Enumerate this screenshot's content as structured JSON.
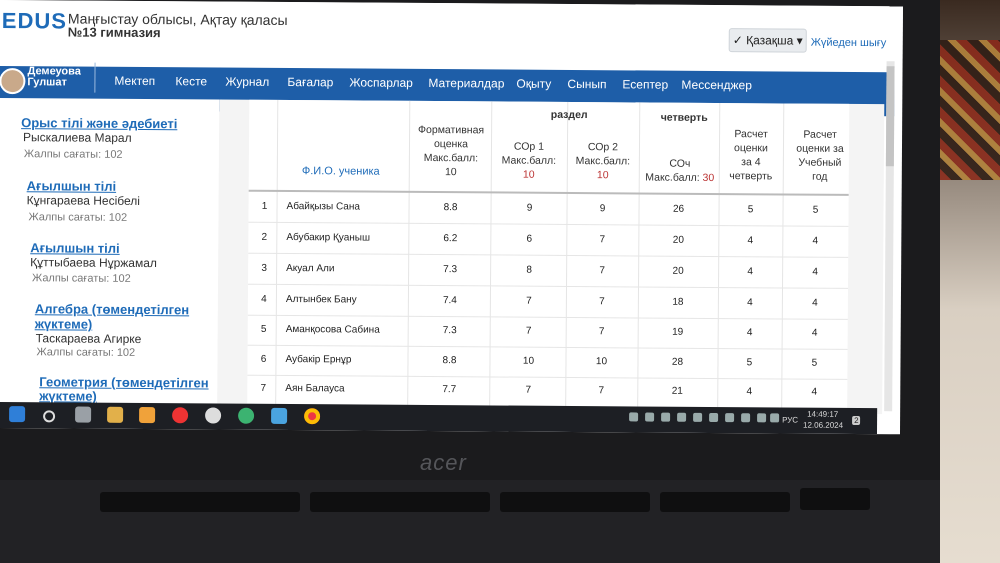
{
  "header": {
    "logo": "EDUS",
    "region": "Маңғыстау облысы, Ақтау қаласы",
    "school": "№13 гимназия",
    "language_button": "✓ Қазақша ▾",
    "logout": "Жүйеден шығу"
  },
  "user": {
    "name_line1": "Демеуова",
    "name_line2": "Гулшат"
  },
  "nav": [
    "Мектеп",
    "Кесте",
    "Журнал",
    "Бағалар",
    "Жоспарлар",
    "Материалдар",
    "Оқыту",
    "Сынып",
    "Есептер",
    "Мессенджер"
  ],
  "sidebar": {
    "subjects": [
      {
        "name": "Орыс тілі және әдебиеті",
        "teacher": "Рыскалиева Марал",
        "hours": "Жалпы сағаты: 102"
      },
      {
        "name": "Ағылшын тілі",
        "teacher": "Кұнгараева Несібелі",
        "hours": "Жалпы сағаты: 102"
      },
      {
        "name": "Ағылшын тілі",
        "teacher": "Құттыбаева Нұржамал",
        "hours": "Жалпы сағаты: 102"
      },
      {
        "name": "Алгебра (төмендетілген",
        "name2": "жүктеме)",
        "teacher": "Таскараева Агирке",
        "hours": "Жалпы сағаты: 102"
      },
      {
        "name": "Геометрия (төмендетілген",
        "name2": "жүктеме)"
      }
    ]
  },
  "table": {
    "headers": {
      "name": "Ф.И.О. ученика",
      "formative": [
        "Формативная",
        "оценка",
        "Макс.балл:",
        "10"
      ],
      "group_razdel": "раздел",
      "group_quarter": "четверть",
      "sor1": [
        "СОр 1",
        "Макс.балл:",
        "10"
      ],
      "sor2": [
        "СОр 2",
        "Макс.балл:",
        "10"
      ],
      "soch": [
        "СОч",
        "Макс.балл: ",
        "30"
      ],
      "q_grade": [
        "Расчет",
        "оценки",
        "за 4",
        "четверть"
      ],
      "y_grade": [
        "Расчет",
        "оценки за",
        "Учебный",
        "год"
      ]
    },
    "rows": [
      {
        "n": "1",
        "name": "Абайқызы Сана",
        "formative": "8.8",
        "sor1": "9",
        "sor2": "9",
        "soch": "26",
        "q": "5",
        "y": "5"
      },
      {
        "n": "2",
        "name": "Абубакир Қуаныш",
        "formative": "6.2",
        "sor1": "6",
        "sor2": "7",
        "soch": "20",
        "q": "4",
        "y": "4"
      },
      {
        "n": "3",
        "name": "Акуал Али",
        "formative": "7.3",
        "sor1": "8",
        "sor2": "7",
        "soch": "20",
        "q": "4",
        "y": "4"
      },
      {
        "n": "4",
        "name": "Алтынбек Бану",
        "formative": "7.4",
        "sor1": "7",
        "sor2": "7",
        "soch": "18",
        "q": "4",
        "y": "4"
      },
      {
        "n": "5",
        "name": "Аманқосова Сабина",
        "formative": "7.3",
        "sor1": "7",
        "sor2": "7",
        "soch": "19",
        "q": "4",
        "y": "4"
      },
      {
        "n": "6",
        "name": "Аубакір Ернұр",
        "formative": "8.8",
        "sor1": "10",
        "sor2": "10",
        "soch": "28",
        "q": "5",
        "y": "5"
      },
      {
        "n": "7",
        "name": "Аян Балауса",
        "formative": "7.7",
        "sor1": "7",
        "sor2": "7",
        "soch": "21",
        "q": "4",
        "y": "4"
      }
    ]
  },
  "taskbar": {
    "lang": "РУС",
    "time": "14:49:17",
    "date": "12.06.2024",
    "notif": "2"
  },
  "device": {
    "brand": "acer"
  }
}
